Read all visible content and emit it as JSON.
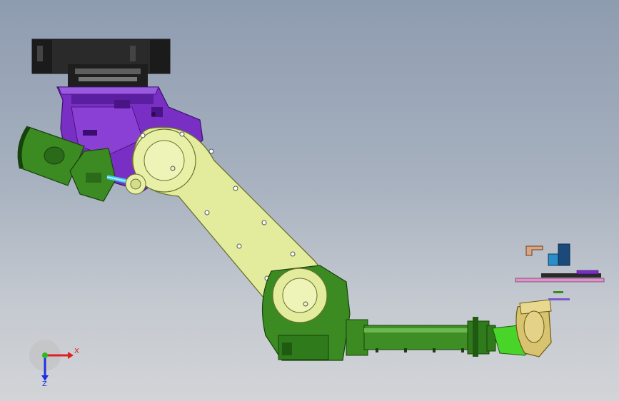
{
  "colors": {
    "background_top": "#8e9cb0",
    "background_bottom": "#d2d4d7",
    "base": "#2a2a2a",
    "purple": "#7a2fc4",
    "purple_dark": "#4b1486",
    "arm": "#e2ec9c",
    "arm_edge": "#6a7030",
    "green": "#3c8a22",
    "green_dark": "#1f5a12",
    "bright_green": "#49d42a",
    "gold": "#d8c470",
    "cyan": "#40c8e8",
    "pink": "#d996c8",
    "tan": "#d9a585",
    "blue": "#2a8ec8",
    "axis_x": "#e02020",
    "axis_y": "#2bb82b",
    "axis_z": "#2030e0"
  },
  "triad": {
    "x_label": "X",
    "z_label": "Z"
  },
  "icons": {
    "triad": "coordinate-triad-icon"
  }
}
